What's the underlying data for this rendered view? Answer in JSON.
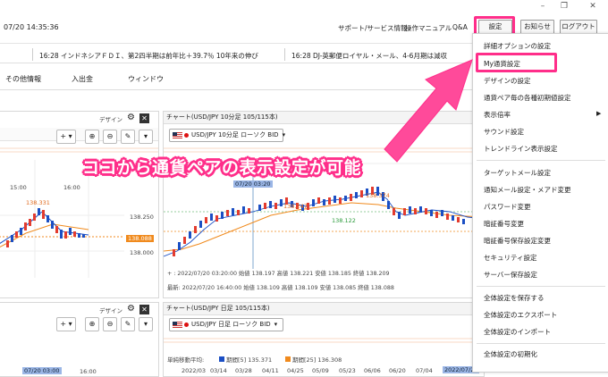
{
  "window": {
    "minimize": "–",
    "restore": "❐",
    "close": "✕"
  },
  "header": {
    "datetime": "07/20 14:35:36",
    "links": [
      "サポート/サービス情報",
      "操作マニュアル",
      "Q&A"
    ],
    "settings_button": "設定",
    "notice_button": "お知らせ",
    "logout_button": "ログアウト"
  },
  "ticker": {
    "item1": "16:28 インドネシアＦＤＩ、第2四半期は前年比＋39.7％ 10年来の伸び",
    "item2": "16:28 DJ-英郵便ロイヤル・メール、4-6月期は減収"
  },
  "menubar": {
    "items": [
      "その他情報",
      "入出金",
      "ウィンドウ"
    ]
  },
  "left_chart": {
    "design_label": "デザイン",
    "x_labels": [
      "15:00",
      "16:00"
    ],
    "y_labels": [
      "138.250",
      "138.000"
    ],
    "high_label": "138.331",
    "price_tag": "138.088",
    "bottom_x_labels": [
      "07/20 03:00",
      "16:00"
    ]
  },
  "main_chart": {
    "title": "チャート(USD/JPY 10分足 105/115本)",
    "design_label": "デザイン",
    "selector": "USD/JPY 10分足 ローソク BID",
    "date_label": "07/20",
    "cursor_label": "07/20 03:20",
    "price_labels": [
      "138.374",
      "138.247",
      "138.122"
    ],
    "info1": "+ : 2022/07/20 03:20:00 始値 138.197 高値 138.221 安値 138.185 終値 138.209",
    "info2": "最新: 2022/07/20 16:40:00 始値 138.109 高値 138.109 安値 138.085 終値 138.088"
  },
  "daily_chart": {
    "title": "チャート(USD/JPY 日足 105/115本)",
    "design_label": "デザイン",
    "selector": "USD/JPY 日足 ローソク BID",
    "ma_text": "単純移動平均:",
    "legend1": "期間[5] 135.371",
    "legend2": "期間[25] 136.308",
    "x_labels": [
      "2022/03",
      "03/14",
      "03/28",
      "04/11",
      "04/25",
      "05/09",
      "05/23",
      "06/06",
      "06/20",
      "07/04"
    ],
    "date_tag": "2022/07/20"
  },
  "dropdown": {
    "items": [
      "詳細オプションの設定",
      "My通貨設定",
      "デザインの設定",
      "通貨ペア毎の各種初期値設定",
      "表示倍率",
      "サウンド設定",
      "トレンドライン表示設定",
      "ターゲットメール設定",
      "通知メール設定・メアド変更",
      "パスワード変更",
      "暗証番号変更",
      "暗証番号保存設定変更",
      "セキュリティ設定",
      "サーバー保存設定",
      "全体設定を保存する",
      "全体設定のエクスポート",
      "全体設定のインポート",
      "全体設定の初期化"
    ],
    "submenu_arrow": "▶"
  },
  "caption": "ココから通貨ペアの表示設定が可能",
  "colors": {
    "highlight": "#ff2e8a",
    "bull": "#1b4fc4",
    "bear": "#e33b2e",
    "ma_orange": "#f08a1d"
  }
}
